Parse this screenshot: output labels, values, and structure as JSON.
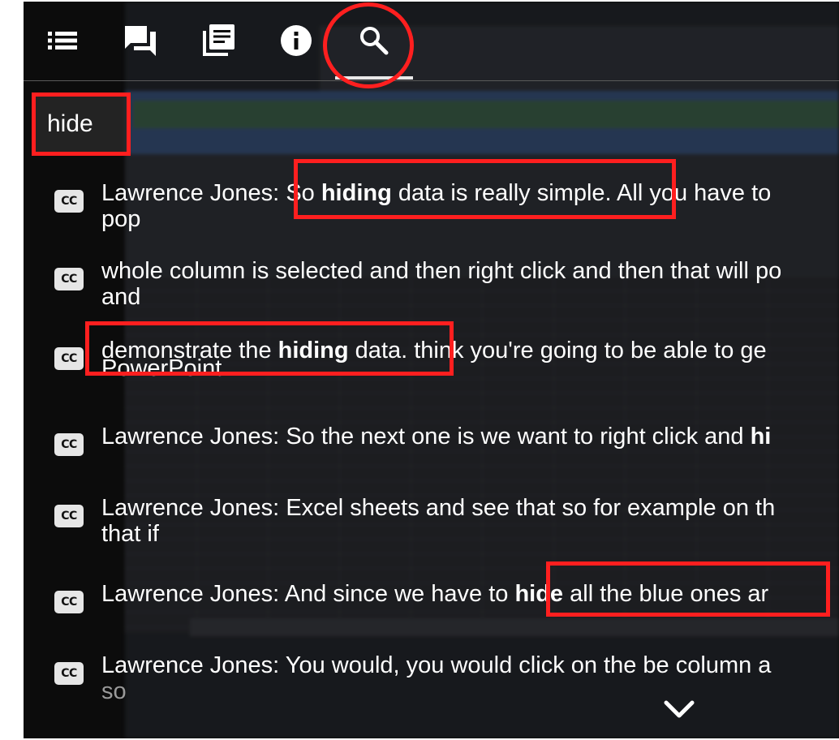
{
  "toolbar": {
    "buttons": [
      {
        "icon": "list-icon",
        "interactable": true
      },
      {
        "icon": "chat-icon",
        "interactable": true
      },
      {
        "icon": "library-icon",
        "interactable": true
      },
      {
        "icon": "info-icon",
        "interactable": true
      },
      {
        "icon": "search-icon",
        "interactable": true,
        "active": true
      }
    ]
  },
  "search": {
    "value": "hide"
  },
  "colors": {
    "annotation_red": "#ff1f1f",
    "panel_bg": "#0c0c0c",
    "text": "#ffffff"
  },
  "results": [
    {
      "line1": {
        "pre": "Lawrence Jones: ",
        "a": "So ",
        "hit": "hiding",
        "b": " data is really simple. All you have to"
      },
      "line2": "pop"
    },
    {
      "line1": {
        "pre": "",
        "a": "whole column is selected and then right click and then that will po",
        "hit": "",
        "b": ""
      },
      "line2": "and"
    },
    {
      "line1": {
        "pre": "",
        "a": "demonstrate the ",
        "hit": "hiding",
        "b": " data.  think you're going to be able to ge"
      },
      "line2": "PowerPoint."
    },
    {
      "line1": {
        "pre": "Lawrence Jones: ",
        "a": "So the next one is we want to right click and ",
        "hit": "hi",
        "b": ""
      },
      "line2": ""
    },
    {
      "line1": {
        "pre": "Lawrence Jones: ",
        "a": "Excel sheets and see that so for example on th",
        "hit": "",
        "b": ""
      },
      "line2": "that if"
    },
    {
      "line1": {
        "pre": "Lawrence Jones: ",
        "a": "And since we have to ",
        "hit": "hide",
        "b": " all the blue ones ar"
      },
      "line2": ""
    },
    {
      "line1": {
        "pre": "Lawrence Jones: ",
        "a": "You would, you would click on the be column a",
        "hit": "",
        "b": ""
      },
      "line2": "so"
    }
  ],
  "cc_label": "CC"
}
